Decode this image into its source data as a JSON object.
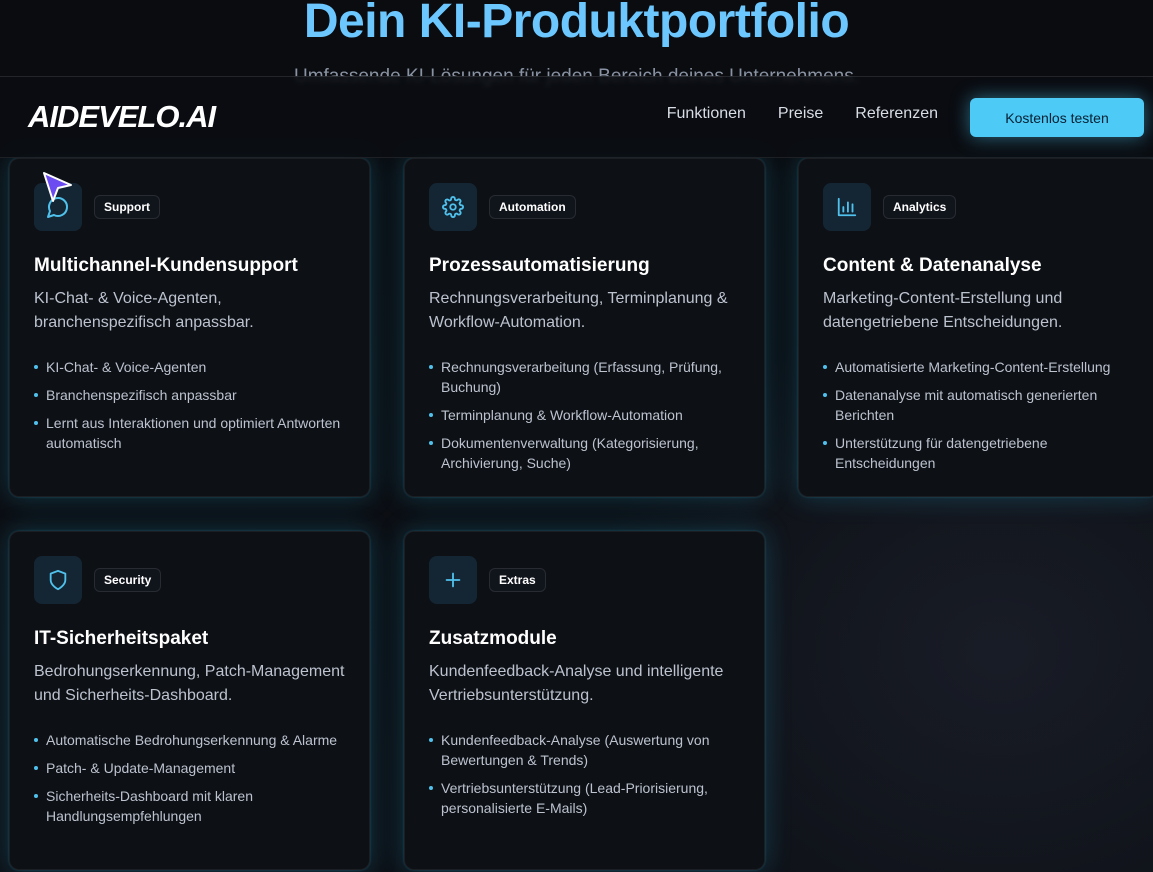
{
  "hero": {
    "title": "Dein KI-Produktportfolio",
    "subtitle": "Umfassende KI-Lösungen für jeden Bereich deines Unternehmens."
  },
  "nav": {
    "logo": "AIDEVELO.AI",
    "links": [
      "Funktionen",
      "Preise",
      "Referenzen"
    ],
    "cta": "Kostenlos testen"
  },
  "cards": [
    {
      "icon": "chat-bubble-icon",
      "badge": "Support",
      "title": "Multichannel-Kundensupport",
      "description": "KI-Chat- & Voice-Agenten, branchenspezifisch anpassbar.",
      "features": [
        "KI-Chat- & Voice-Agenten",
        "Branchenspezifisch anpassbar",
        "Lernt aus Interaktionen und optimiert Antworten automatisch"
      ]
    },
    {
      "icon": "gear-icon",
      "badge": "Automation",
      "title": "Prozessautomatisierung",
      "description": "Rechnungsverarbeitung, Terminplanung & Workflow-Automation.",
      "features": [
        "Rechnungsverarbeitung (Erfassung, Prüfung, Buchung)",
        "Terminplanung & Workflow-Automation",
        "Dokumentenverwaltung (Kategorisierung, Archivierung, Suche)"
      ]
    },
    {
      "icon": "bar-chart-icon",
      "badge": "Analytics",
      "title": "Content & Datenanalyse",
      "description": "Marketing-Content-Erstellung und datengetriebene Entscheidungen.",
      "features": [
        "Automatisierte Marketing-Content-Erstellung",
        "Datenanalyse mit automatisch generierten Berichten",
        "Unterstützung für datengetriebene Entscheidungen"
      ]
    },
    {
      "icon": "shield-icon",
      "badge": "Security",
      "title": "IT-Sicherheitspaket",
      "description": "Bedrohungserkennung, Patch-Management und Sicherheits-Dashboard.",
      "features": [
        "Automatische Bedrohungserkennung & Alarme",
        "Patch- & Update-Management",
        "Sicherheits-Dashboard mit klaren Handlungsempfehlungen"
      ]
    },
    {
      "icon": "plus-icon",
      "badge": "Extras",
      "title": "Zusatzmodule",
      "description": "Kundenfeedback-Analyse und intelligente Vertriebsunterstützung.",
      "features": [
        "Kundenfeedback-Analyse (Auswertung von Bewertungen & Trends)",
        "Vertriebsunterstützung (Lead-Priorisierung, personalisierte E-Mails)"
      ]
    }
  ],
  "colors": {
    "accent": "#4dcaf6",
    "title": "#6cc7ff",
    "background": "#0b0d12",
    "card": "#0d1015"
  }
}
